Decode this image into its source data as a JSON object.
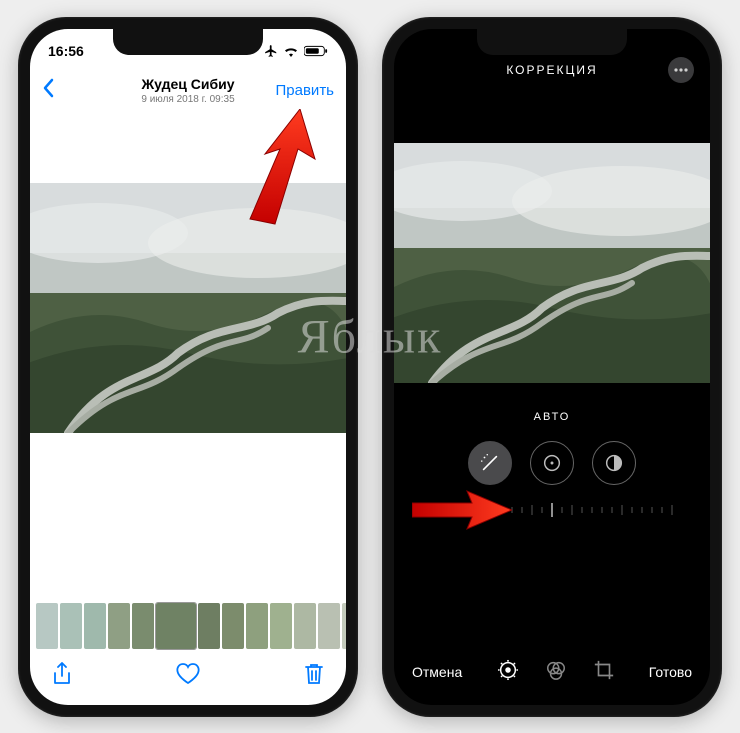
{
  "left": {
    "statusbar": {
      "time": "16:56"
    },
    "nav": {
      "title": "Жудец Сибиу",
      "subtitle": "9 июля 2018 г.  09:35",
      "edit_label": "Править"
    },
    "toolbar_icons": {
      "share": "share-icon",
      "heart": "heart-icon",
      "trash": "trash-icon"
    }
  },
  "right": {
    "header": {
      "title": "КОРРЕКЦИЯ"
    },
    "auto_label": "АВТО",
    "adjust_buttons": [
      "magic-wand-icon",
      "exposure-icon",
      "contrast-icon"
    ],
    "bottom": {
      "cancel": "Отмена",
      "done": "Готово"
    }
  },
  "colors": {
    "ios_blue": "#007aff",
    "arrow_red": "#ff2a1a"
  },
  "watermark": "Яблык"
}
